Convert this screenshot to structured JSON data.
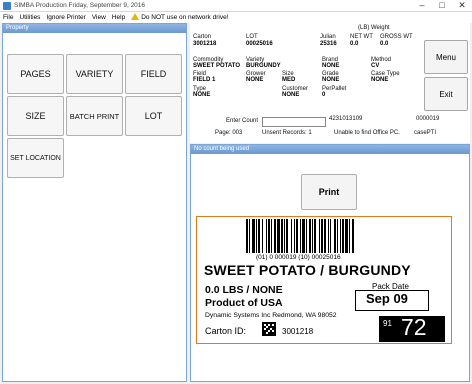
{
  "window": {
    "title": "SIMBA Production Friday, September 9, 2016"
  },
  "menu": {
    "items": [
      "File",
      "Utilities",
      "Ignore Printer",
      "View",
      "Help"
    ],
    "warning": "Do NOT use on network drive!"
  },
  "left_panel": {
    "title": "Property",
    "buttons": [
      "PAGES",
      "VARIETY",
      "FIELD",
      "SIZE",
      "BATCH PRINT",
      "LOT",
      "SET LOCATION"
    ]
  },
  "info": {
    "weight_header": "(LB) Weight",
    "carton_label": "Carton",
    "carton_value": "3001218",
    "lot_label": "LOT",
    "lot_value": "00025016",
    "julian_label": "Julian",
    "julian_value": "25316",
    "net_label": "NET WT",
    "net_value": "0.0",
    "gross_label": "GROSS WT",
    "gross_value": "0.0",
    "commodity_label": "Commodity",
    "commodity_value": "SWEET POTATO",
    "variety_label": "Variety",
    "variety_value": "BURGUNDY",
    "brand_label": "Brand",
    "brand_value": "NONE",
    "method_label": "Method",
    "method_value": "CV",
    "field_label": "Field",
    "field_value": "FIELD 1",
    "grower_label": "Grower",
    "grower_value": "NONE",
    "size_label": "Size",
    "size_value": "MED",
    "grade_label": "Grade",
    "grade_value": "NONE",
    "case_type_label": "Case Type",
    "case_type_value": "NONE",
    "type_label": "Type",
    "type_value": "NONE",
    "customer_label": "Customer",
    "customer_value": "NONE",
    "per_pallet_label": "PerPallet",
    "per_pallet_value": "0",
    "enter_count_label": "Enter Count",
    "code_number": "4231013109",
    "right_number": "0000019",
    "page_text": "Page:  003",
    "unsent_text": "Unsent Records:  1",
    "office_text": "Unable to find Office PC.",
    "case_text": "casePTI"
  },
  "side_buttons": {
    "menu": "Menu",
    "exit": "Exit"
  },
  "right_panel": {
    "title": "No count being used",
    "print_button": "Print"
  },
  "label": {
    "barcode_text": "(01) 0 000019  (10) 00025016",
    "product": "SWEET POTATO / BURGUNDY",
    "weight_line": "0.0 LBS / NONE",
    "origin": "Product of USA",
    "pack_date_label": "Pack Date",
    "pack_date": "Sep 09",
    "company": "Dynamic Systems Inc Redmond, WA 98052",
    "carton_id_label": "Carton ID:",
    "carton_id": "3001218",
    "small_code": "91",
    "big_code": "72"
  }
}
